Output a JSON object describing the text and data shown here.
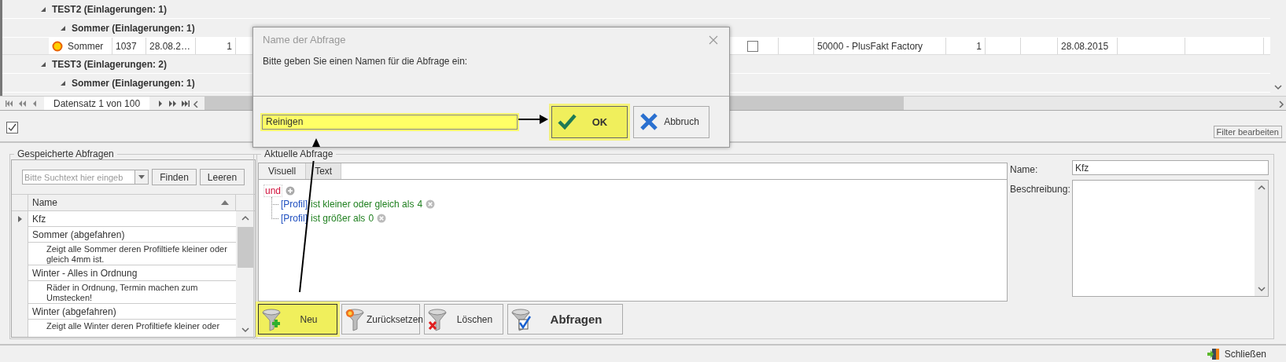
{
  "grid": {
    "groups": [
      {
        "label": "TEST2 (Einlagerungen: 1)",
        "expanded": true,
        "children": [
          {
            "label": "Sommer (Einlagerungen: 1)",
            "expanded": true,
            "rows": [
              {
                "cells": [
                  {
                    "kind": "season",
                    "text": "Sommer"
                  },
                  {
                    "kind": "text",
                    "text": "1037"
                  },
                  {
                    "kind": "text",
                    "text": "28.08.2…"
                  },
                  {
                    "kind": "number",
                    "text": "1"
                  },
                  {
                    "kind": "checkbox",
                    "checked": false
                  },
                  {
                    "kind": "blank"
                  },
                  {
                    "kind": "text",
                    "text": "50000 - PlusFakt Factory"
                  },
                  {
                    "kind": "number",
                    "text": "1"
                  },
                  {
                    "kind": "blank"
                  },
                  {
                    "kind": "blank"
                  },
                  {
                    "kind": "text",
                    "text": "28.08.2015"
                  },
                  {
                    "kind": "blank"
                  },
                  {
                    "kind": "blank"
                  }
                ]
              }
            ]
          }
        ]
      },
      {
        "label": "TEST3 (Einlagerungen: 2)",
        "expanded": true,
        "children": [
          {
            "label": "Sommer (Einlagerungen: 1)",
            "expanded": true
          }
        ]
      }
    ]
  },
  "navigator": {
    "text": "Datensatz 1 von 100"
  },
  "filter_bar": {
    "checked": true,
    "button": "Filter bearbeiten"
  },
  "saved_queries": {
    "title": "Gespeicherte Abfragen",
    "search": {
      "placeholder": "Bitte Suchtext hier eingeb"
    },
    "buttons": [
      "Finden",
      "Leeren"
    ],
    "column": "Name",
    "rows": [
      {
        "kind": "name",
        "text": "Kfz",
        "selected": true
      },
      {
        "kind": "name",
        "text": "Sommer (abgefahren)",
        "selected": false
      },
      {
        "kind": "description",
        "text": "Zeigt alle Sommer deren Profiltiefe kleiner oder gleich 4mm ist.",
        "selected": false
      },
      {
        "kind": "name",
        "text": "Winter - Alles in Ordnung",
        "selected": false
      },
      {
        "kind": "description",
        "text": "Räder in Ordnung, Termin machen zum Umstecken!",
        "selected": false
      },
      {
        "kind": "name",
        "text": "Winter (abgefahren)",
        "selected": false
      },
      {
        "kind": "description",
        "text": "Zeigt alle Winter deren Profiltiefe kleiner oder",
        "selected": false
      }
    ]
  },
  "current_query": {
    "title": "Aktuelle Abfrage",
    "tabs": [
      {
        "label": "Visuell",
        "selected": true
      },
      {
        "label": "Text",
        "selected": false
      }
    ],
    "operator": "und",
    "conditions": [
      {
        "field": "[Profil]",
        "op": "ist kleiner oder gleich als",
        "value": "4"
      },
      {
        "field": "[Profil]",
        "op": "ist größer als",
        "value": "0"
      }
    ],
    "buttons": [
      {
        "kind": "new",
        "label": "Neu",
        "highlighted": true
      },
      {
        "kind": "reset",
        "label": "Zurücksetzen",
        "highlighted": false
      },
      {
        "kind": "delete",
        "label": "Löschen",
        "highlighted": false
      },
      {
        "kind": "query",
        "label": "Abfragen",
        "highlighted": false
      }
    ],
    "name_label": "Name:",
    "name_value": "Kfz",
    "description_label": "Beschreibung:"
  },
  "status_bar": {
    "close": "Schließen"
  },
  "dialog": {
    "title": "Name der Abfrage",
    "prompt": "Bitte geben Sie einen Namen für die Abfrage ein:",
    "value": "Reinigen",
    "highlighted": true,
    "buttons": [
      {
        "kind": "ok",
        "label": "OK",
        "highlighted": true
      },
      {
        "kind": "cancel",
        "label": "Abbruch",
        "highlighted": false
      }
    ]
  }
}
